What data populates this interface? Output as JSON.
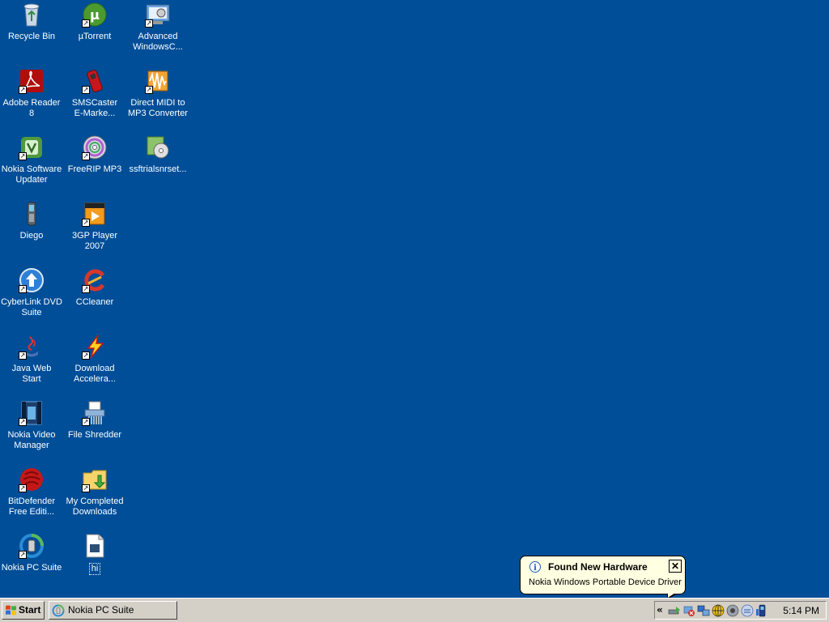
{
  "desktop": {
    "background": "#004e98",
    "icons": [
      {
        "label": "Recycle Bin",
        "icon": "recycle-bin-icon"
      },
      {
        "label": "µTorrent",
        "icon": "utorrent-icon"
      },
      {
        "label": "Advanced\nWindowsC...",
        "icon": "advanced-windowscare-icon"
      },
      {
        "label": "Adobe Reader\n8",
        "icon": "adobe-reader-icon"
      },
      {
        "label": "SMSCaster\nE-Marke...",
        "icon": "smscaster-icon"
      },
      {
        "label": "Direct MIDI to\nMP3 Converter",
        "icon": "midi-converter-icon"
      },
      {
        "label": "Nokia Software\nUpdater",
        "icon": "nokia-updater-icon"
      },
      {
        "label": "FreeRIP MP3",
        "icon": "freerip-icon"
      },
      {
        "label": "ssftrialsnrset...",
        "icon": "setup-installer-icon"
      },
      {
        "label": "Diego",
        "icon": "phone-icon"
      },
      {
        "label": "3GP Player\n2007",
        "icon": "3gp-player-icon"
      },
      {
        "label": "CyberLink DVD\nSuite",
        "icon": "cyberlink-dvd-icon"
      },
      {
        "label": "CCleaner",
        "icon": "ccleaner-icon"
      },
      {
        "label": "Java Web\nStart",
        "icon": "java-icon"
      },
      {
        "label": "Download\nAccelera...",
        "icon": "download-accelerator-icon"
      },
      {
        "label": "Nokia Video\nManager",
        "icon": "nokia-video-manager-icon"
      },
      {
        "label": "File Shredder",
        "icon": "file-shredder-icon"
      },
      {
        "label": "BitDefender\nFree Editi...",
        "icon": "bitdefender-icon"
      },
      {
        "label": "My Completed\nDownloads",
        "icon": "folder-download-icon"
      },
      {
        "label": "Nokia PC Suite",
        "icon": "nokia-pc-suite-icon"
      },
      {
        "label": "hi",
        "icon": "text-document-icon"
      }
    ]
  },
  "taskbar": {
    "start_label": "Start",
    "tasks": [
      {
        "label": "Nokia PC Suite",
        "icon": "nokia-pc-suite-icon"
      }
    ],
    "tray": {
      "chevron": "«",
      "icons": [
        "safely-remove-hardware-icon",
        "network-disabled-icon",
        "network-icon",
        "globe-icon",
        "audio-icon",
        "messenger-icon",
        "phone-connection-icon"
      ],
      "clock": "5:14 PM"
    }
  },
  "balloon": {
    "title": "Found New Hardware",
    "text": "Nokia Windows Portable Device Driver",
    "close": "✕",
    "info_glyph": "i"
  }
}
